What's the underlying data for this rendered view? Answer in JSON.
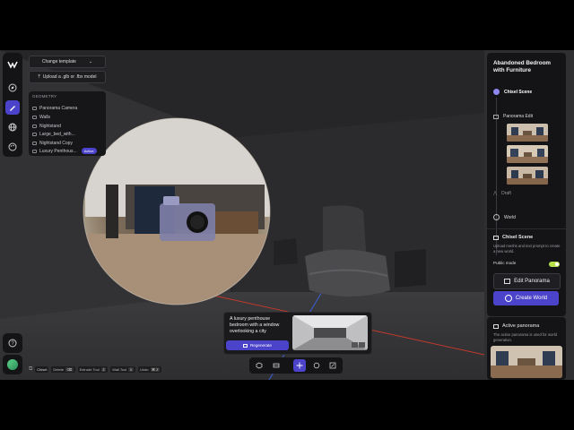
{
  "template": {
    "change_label": "Change template",
    "upload_label": "Upload a .glb or .fbx model"
  },
  "geometry": {
    "title": "GEOMETRY",
    "items": [
      {
        "label": "Panorama Camera",
        "icon": "camera-icon"
      },
      {
        "label": "Walls",
        "icon": "cube-icon"
      },
      {
        "label": "Nightstand",
        "icon": "cube-icon"
      },
      {
        "label": "Large_bed_with...",
        "icon": "cube-icon"
      },
      {
        "label": "Nightstand Copy",
        "icon": "cube-icon"
      },
      {
        "label": "Luxury Penthous...",
        "icon": "image-icon",
        "badge": "Active"
      }
    ]
  },
  "right_panel": {
    "title": "Abandoned Bedroom with Furniture",
    "steps": {
      "chisel": "Chisel Scene",
      "panorama_edit": "Panorama Edit",
      "draft": "Draft",
      "world": "World"
    },
    "chisel_section": {
      "title": "Chisel Scene",
      "description": "Upload meshs and text prompt to create a new world.",
      "public_mode_label": "Public mode",
      "public_mode": true
    },
    "edit_panorama_label": "Edit Panorama",
    "create_world_label": "Create World",
    "active_panorama": {
      "title": "Active panorama",
      "description": "The active panorama is used for world generation."
    }
  },
  "prompt_card": {
    "text": "A luxury penthouse bedroom with a window overlooking a city",
    "regenerate_label": "Regenerate"
  },
  "shortcuts": [
    {
      "label": "Chisel",
      "key": ""
    },
    {
      "label": "Delete",
      "key": "⌫"
    },
    {
      "label": "Extrude Tool",
      "key": "Z"
    },
    {
      "label": "Wall Tool",
      "key": "X"
    },
    {
      "label": "Undo",
      "key": "⌘ Z"
    }
  ],
  "colors": {
    "accent": "#4b43c9",
    "toggle_on": "#b8e04a",
    "panel": "#141416"
  }
}
